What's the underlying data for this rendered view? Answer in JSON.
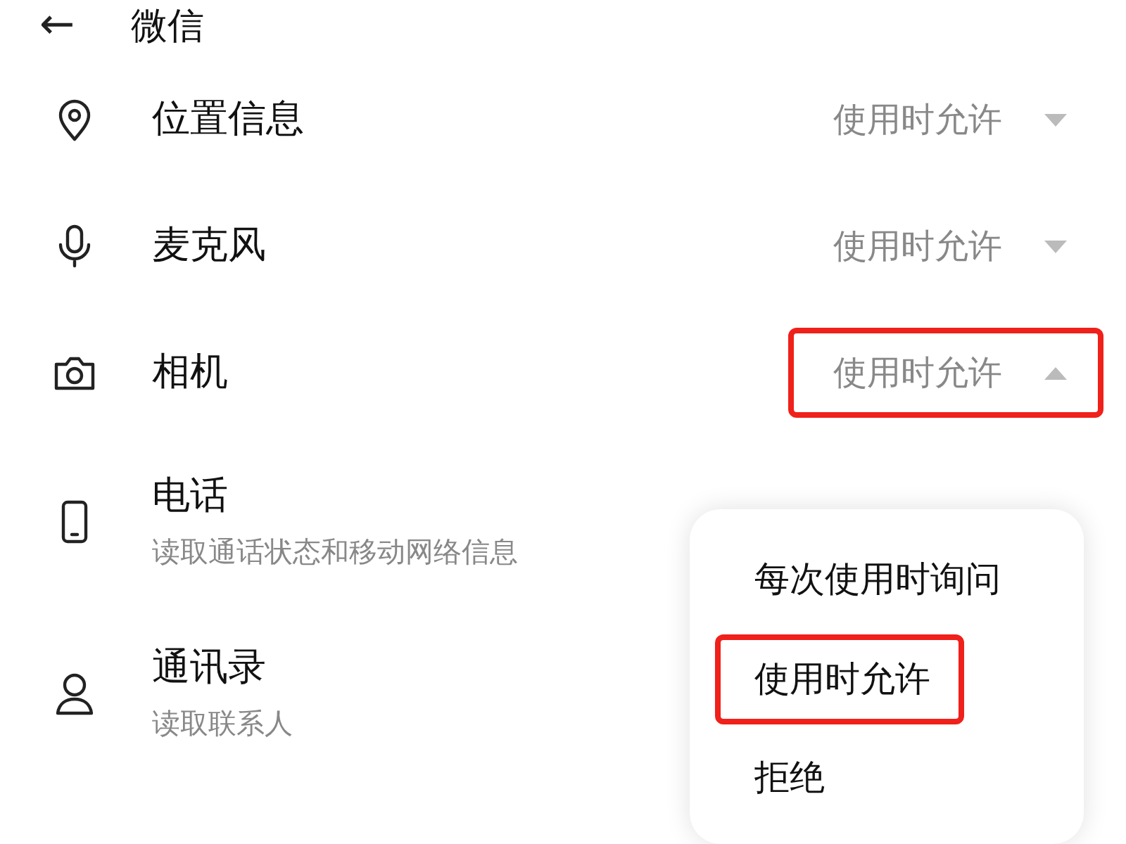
{
  "header": {
    "back": "←",
    "title": "微信"
  },
  "permissions": [
    {
      "label": "位置信息",
      "value": "使用时允许",
      "expanded": false,
      "highlighted": false
    },
    {
      "label": "麦克风",
      "value": "使用时允许",
      "expanded": false,
      "highlighted": false
    },
    {
      "label": "相机",
      "value": "使用时允许",
      "expanded": true,
      "highlighted": true
    },
    {
      "label": "电话",
      "subtitle": "读取通话状态和移动网络信息"
    },
    {
      "label": "通讯录",
      "subtitle": "读取联系人"
    }
  ],
  "menu": {
    "options": [
      {
        "label": "每次使用时询问",
        "highlighted": false
      },
      {
        "label": "使用时允许",
        "highlighted": true
      },
      {
        "label": "拒绝",
        "highlighted": false
      }
    ]
  }
}
